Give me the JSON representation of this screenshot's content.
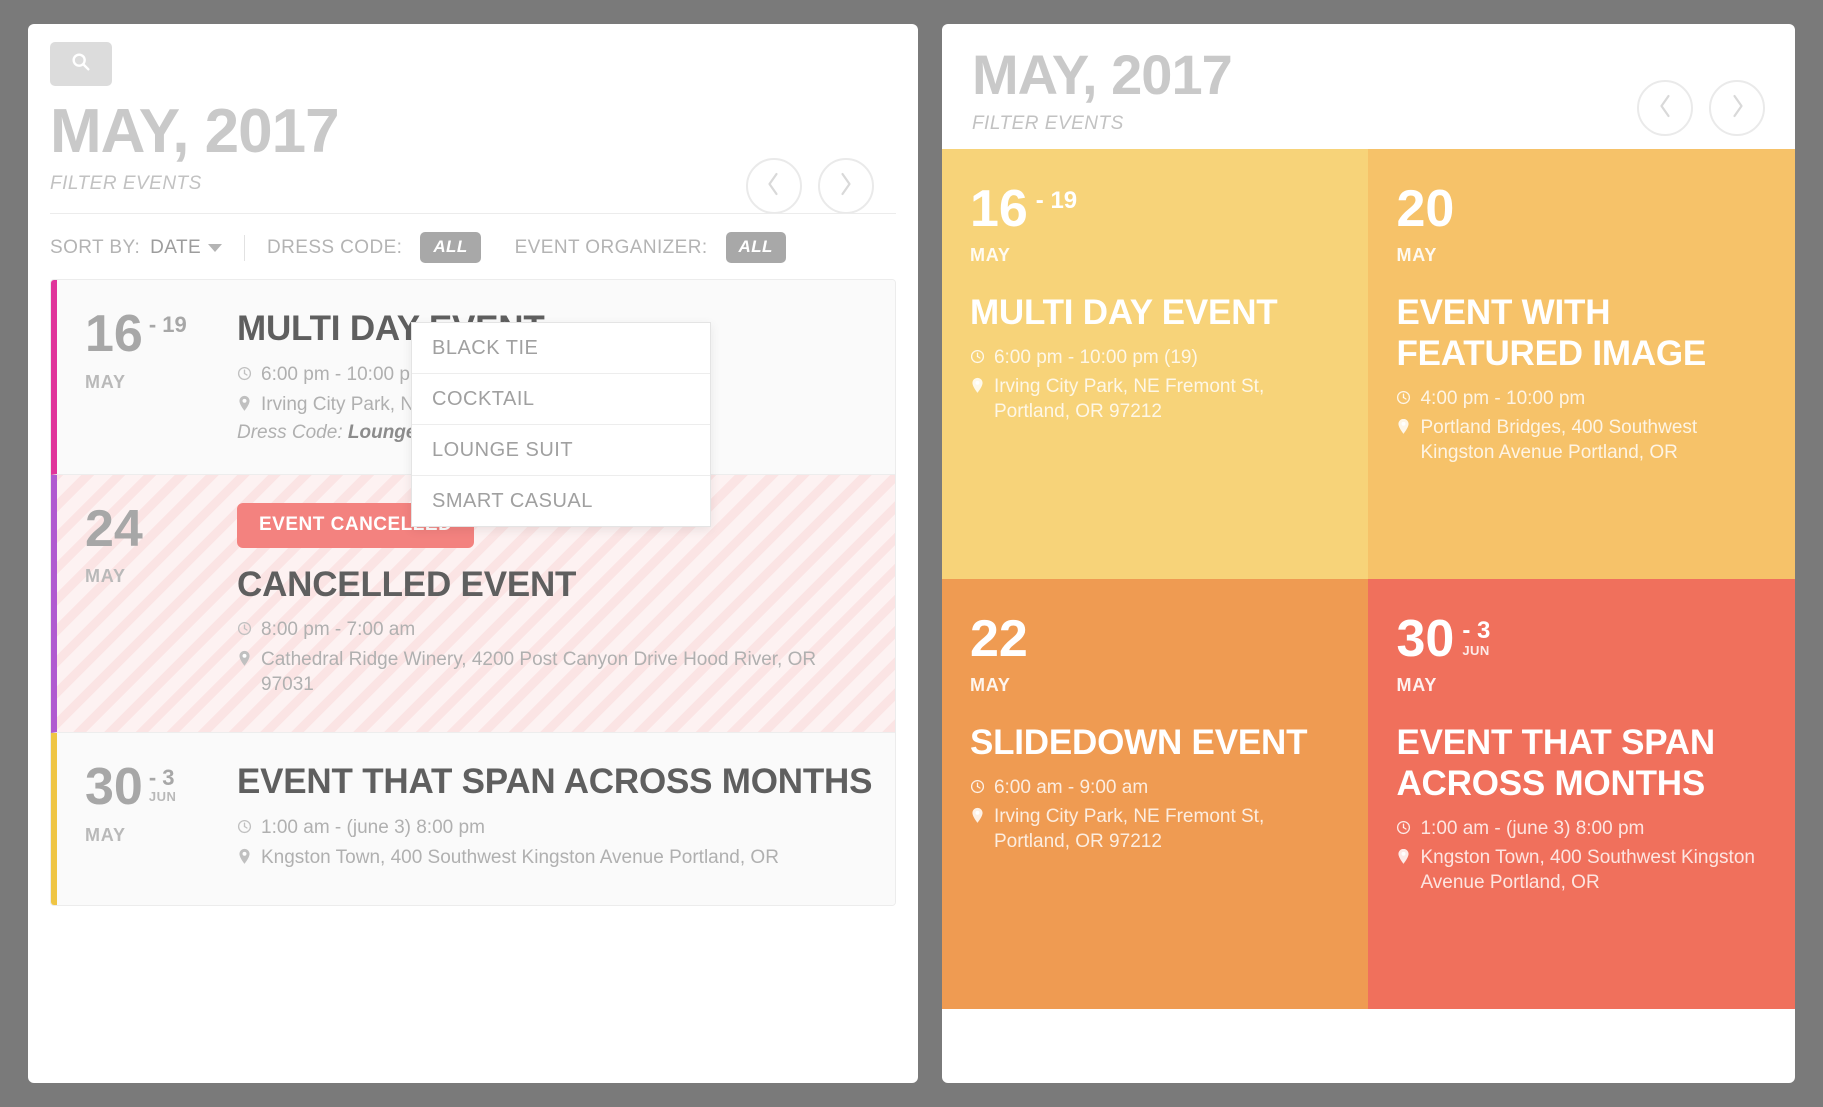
{
  "left_panel": {
    "search_icon": "search-icon",
    "month_title": "MAY, 2017",
    "filter_label": "FILTER EVENTS",
    "nav": {
      "prev": "chevron-left-icon",
      "next": "chevron-right-icon"
    },
    "sortbar": {
      "sort_by_label": "SORT BY:",
      "sort_by_value": "DATE",
      "dress_code_label": "DRESS CODE:",
      "dress_code_value": "ALL",
      "organizer_label": "EVENT ORGANIZER:",
      "organizer_value": "ALL"
    },
    "dropdown": {
      "open": true,
      "options": [
        "BLACK TIE",
        "COCKTAIL",
        "LOUNGE SUIT",
        "SMART CASUAL"
      ]
    },
    "events": [
      {
        "day": "16",
        "day_end": "19",
        "day_end_month": "",
        "month": "MAY",
        "title": "MULTI DAY EVENT",
        "time": "6:00 pm - 10:00 pm (19)",
        "location": "Irving City Park, NE Fremont St, Portland, OR 97212",
        "dress_code_label": "Dress Code:",
        "dress_code_value": "Lounge Suit",
        "accent": "#e0349a",
        "cancelled": false,
        "badge": ""
      },
      {
        "day": "24",
        "day_end": "",
        "day_end_month": "",
        "month": "MAY",
        "title": "CANCELLED EVENT",
        "time": "8:00 pm - 7:00 am",
        "location": "Cathedral Ridge Winery, 4200 Post Canyon Drive Hood River, OR 97031",
        "dress_code_label": "",
        "dress_code_value": "",
        "accent": "#b05ad0",
        "cancelled": true,
        "badge": "EVENT CANCELLED"
      },
      {
        "day": "30",
        "day_end": "3",
        "day_end_month": "JUN",
        "month": "MAY",
        "title": "EVENT THAT SPAN ACROSS MONTHS",
        "time": "1:00 am - (june 3) 8:00 pm",
        "location": "Kngston Town, 400 Southwest Kingston Avenue Portland, OR",
        "dress_code_label": "",
        "dress_code_value": "",
        "accent": "#efc544",
        "cancelled": false,
        "badge": ""
      }
    ]
  },
  "right_panel": {
    "month_title": "MAY, 2017",
    "filter_label": "FILTER EVENTS",
    "nav": {
      "prev": "chevron-left-icon",
      "next": "chevron-right-icon"
    },
    "tiles": [
      {
        "day": "16",
        "day_end": "19",
        "day_end_month": "",
        "month": "MAY",
        "title": "MULTI DAY EVENT",
        "time": "6:00 pm - 10:00 pm (19)",
        "location": "Irving City Park, NE Fremont St, Portland, OR 97212",
        "bg": "#f7d379"
      },
      {
        "day": "20",
        "day_end": "",
        "day_end_month": "",
        "month": "MAY",
        "title": "EVENT WITH FEATURED IMAGE",
        "time": "4:00 pm - 10:00 pm",
        "location": "Portland Bridges, 400 Southwest Kingston Avenue Portland, OR",
        "bg": "#f6c269"
      },
      {
        "day": "22",
        "day_end": "",
        "day_end_month": "",
        "month": "MAY",
        "title": "SLIDEDOWN EVENT",
        "time": "6:00 am - 9:00 am",
        "location": "Irving City Park, NE Fremont St, Portland, OR 97212",
        "bg": "#ef9b52"
      },
      {
        "day": "30",
        "day_end": "3",
        "day_end_month": "JUN",
        "month": "MAY",
        "title": "EVENT THAT SPAN ACROSS MONTHS",
        "time": "1:00 am - (june 3) 8:00 pm",
        "location": "Kngston Town, 400 Southwest Kingston Avenue Portland, OR",
        "bg": "#f0705c"
      }
    ]
  }
}
